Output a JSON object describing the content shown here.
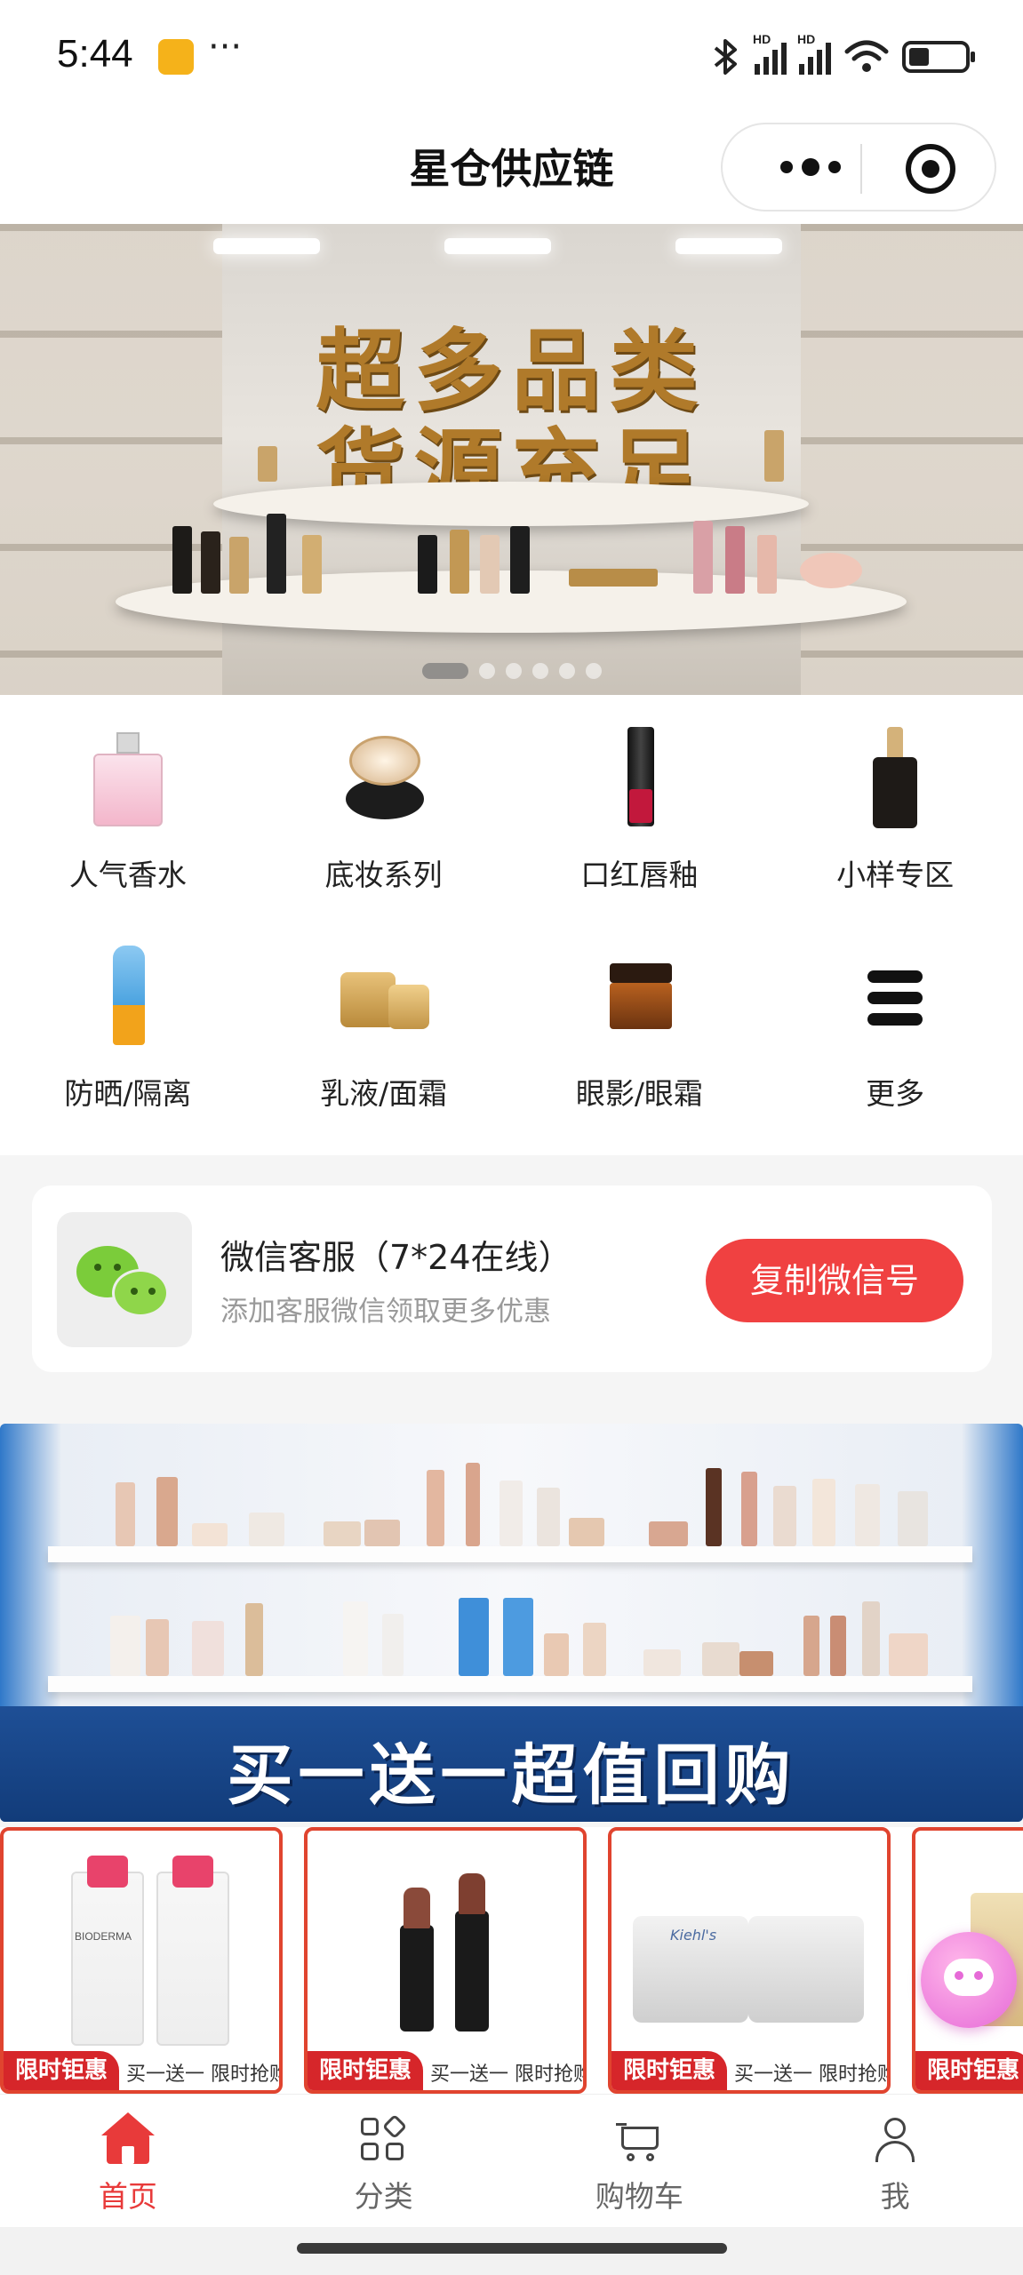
{
  "status_bar": {
    "time": "5:44",
    "dots": "···",
    "signal_label_1": "HD",
    "signal_label_2": "HD",
    "icons": [
      "bluetooth-icon",
      "signal-icon",
      "signal-icon",
      "wifi-icon",
      "battery-icon"
    ]
  },
  "header": {
    "title": "星仓供应链"
  },
  "banner": {
    "headline_line1": "超多品类",
    "headline_line2": "货源充足",
    "slide_count": 6,
    "active_slide": 1
  },
  "categories": [
    {
      "label": "人气香水",
      "icon": "perfume-icon"
    },
    {
      "label": "底妆系列",
      "icon": "cushion-icon"
    },
    {
      "label": "口红唇釉",
      "icon": "lipstick-icon"
    },
    {
      "label": "小样专区",
      "icon": "serum-icon"
    },
    {
      "label": "防晒/隔离",
      "icon": "sunscreen-icon"
    },
    {
      "label": "乳液/面霜",
      "icon": "cream-icon"
    },
    {
      "label": "眼影/眼霜",
      "icon": "eye-cream-icon"
    },
    {
      "label": "更多",
      "icon": "more-list-icon"
    }
  ],
  "wechat_service": {
    "title": "微信客服（7*24在线）",
    "subtitle": "添加客服微信领取更多优惠",
    "button_label": "复制微信号"
  },
  "promo_banner": {
    "text": "买一送一超值回购"
  },
  "products": [
    {
      "tag": "限时钜惠",
      "caption": "买一送一 限时抢购",
      "brand": "BIODERMA"
    },
    {
      "tag": "限时钜惠",
      "caption": "买一送一 限时抢购",
      "brand": ""
    },
    {
      "tag": "限时钜惠",
      "caption": "买一送一 限时抢购",
      "brand": "Kiehl's"
    },
    {
      "tag": "限时钜惠",
      "caption": "",
      "brand": ""
    }
  ],
  "tabbar": {
    "tabs": [
      {
        "label": "首页",
        "icon": "home-icon",
        "active": true
      },
      {
        "label": "分类",
        "icon": "category-grid-icon",
        "active": false
      },
      {
        "label": "购物车",
        "icon": "cart-icon",
        "active": false
      },
      {
        "label": "我",
        "icon": "user-icon",
        "active": false
      }
    ]
  },
  "colors": {
    "accent": "#e83a3a",
    "button_red": "#f04141",
    "wechat_green": "#7bcc3a",
    "promo_blue": "#1e4f96"
  }
}
